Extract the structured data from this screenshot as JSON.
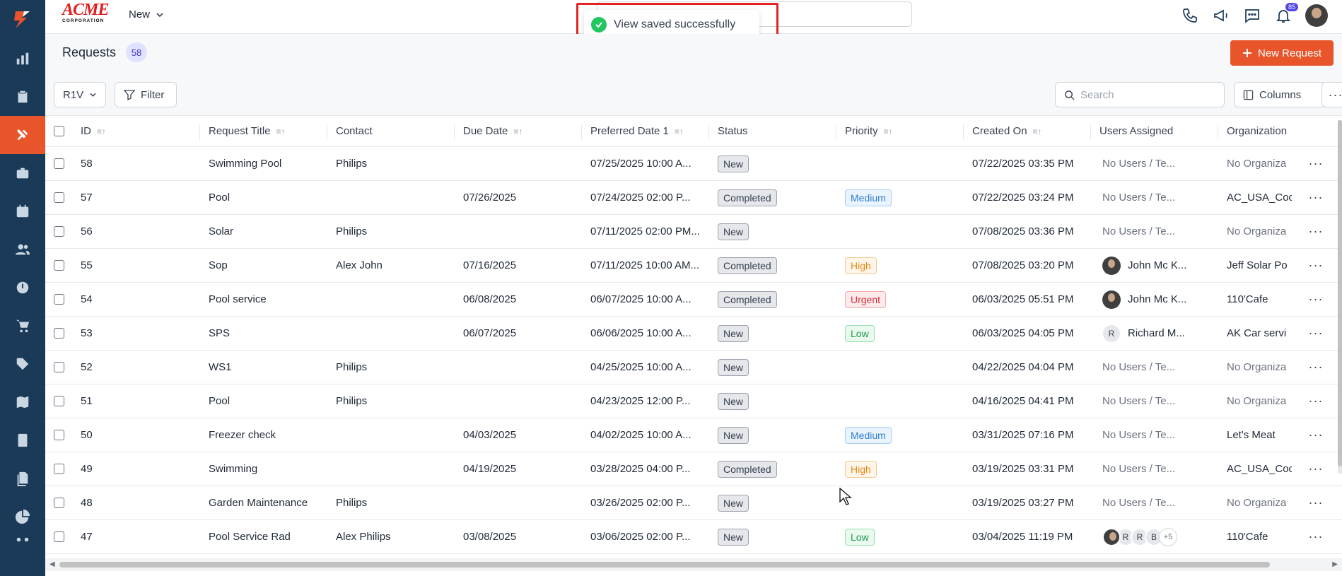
{
  "header": {
    "logo_word": "ACME",
    "logo_sub": "CORPORATION",
    "new_label": "New",
    "notification_count": "85"
  },
  "toast": {
    "message": "View saved successfully"
  },
  "page": {
    "title": "Requests",
    "count": "58",
    "new_button": "New Request"
  },
  "toolbar": {
    "view_label": "R1V",
    "filter_label": "Filter",
    "search_placeholder": "Search",
    "columns_label": "Columns"
  },
  "columns": {
    "id": "ID",
    "title": "Request Title",
    "contact": "Contact",
    "due": "Due Date",
    "pref": "Preferred Date 1",
    "status": "Status",
    "priority": "Priority",
    "created": "Created On",
    "users": "Users Assigned",
    "org": "Organization"
  },
  "rows": [
    {
      "id": "58",
      "title": "Swimming Pool",
      "contact": "Philips",
      "due": "",
      "pref": "07/25/2025 10:00 A...",
      "status": "New",
      "priority": "",
      "created": "07/22/2025 03:35 PM",
      "users": "No Users / Te...",
      "org": "No Organiza"
    },
    {
      "id": "57",
      "title": "Pool",
      "contact": "",
      "due": "07/26/2025",
      "pref": "07/24/2025 02:00 P...",
      "status": "Completed",
      "priority": "Medium",
      "created": "07/22/2025 03:24 PM",
      "users": "No Users / Te...",
      "org": "AC_USA_Coo"
    },
    {
      "id": "56",
      "title": "Solar",
      "contact": "Philips",
      "due": "",
      "pref": "07/11/2025 02:00 PM...",
      "status": "New",
      "priority": "",
      "created": "07/08/2025 03:36 PM",
      "users": "No Users / Te...",
      "org": "No Organiza"
    },
    {
      "id": "55",
      "title": "Sop",
      "contact": "Alex John",
      "due": "07/16/2025",
      "pref": "07/11/2025 10:00 AM...",
      "status": "Completed",
      "priority": "High",
      "created": "07/08/2025 03:20 PM",
      "users": "John Mc K...",
      "org": "Jeff Solar Po"
    },
    {
      "id": "54",
      "title": "Pool service",
      "contact": "",
      "due": "06/08/2025",
      "pref": "06/07/2025 10:00 A...",
      "status": "Completed",
      "priority": "Urgent",
      "created": "06/03/2025 05:51 PM",
      "users": "John Mc K...",
      "org": "110'Cafe"
    },
    {
      "id": "53",
      "title": "SPS",
      "contact": "",
      "due": "06/07/2025",
      "pref": "06/06/2025 10:00 A...",
      "status": "New",
      "priority": "Low",
      "created": "06/03/2025 04:05 PM",
      "users": "Richard M...",
      "user_initial": "R",
      "org": "AK Car servi"
    },
    {
      "id": "52",
      "title": "WS1",
      "contact": "Philips",
      "due": "",
      "pref": "04/25/2025 10:00 A...",
      "status": "New",
      "priority": "",
      "created": "04/22/2025 04:04 PM",
      "users": "No Users / Te...",
      "org": "No Organiza"
    },
    {
      "id": "51",
      "title": "Pool",
      "contact": "Philips",
      "due": "",
      "pref": "04/23/2025 12:00 P...",
      "status": "New",
      "priority": "",
      "created": "04/16/2025 04:41 PM",
      "users": "No Users / Te...",
      "org": "No Organiza"
    },
    {
      "id": "50",
      "title": "Freezer check",
      "contact": "",
      "due": "04/03/2025",
      "pref": "04/02/2025 10:00 A...",
      "status": "New",
      "priority": "Medium",
      "created": "03/31/2025 07:16 PM",
      "users": "No Users / Te...",
      "org": "Let's Meat"
    },
    {
      "id": "49",
      "title": "Swimming",
      "contact": "",
      "due": "04/19/2025",
      "pref": "03/28/2025 04:00 P...",
      "status": "Completed",
      "priority": "High",
      "created": "03/19/2025 03:31 PM",
      "users": "No Users / Te...",
      "org": "AC_USA_Coo"
    },
    {
      "id": "48",
      "title": "Garden Maintenance",
      "contact": "Philips",
      "due": "",
      "pref": "03/26/2025 02:00 P...",
      "status": "New",
      "priority": "",
      "created": "03/19/2025 03:27 PM",
      "users": "No Users / Te...",
      "org": "No Organiza"
    },
    {
      "id": "47",
      "title": "Pool Service Rad",
      "contact": "Alex Philips",
      "due": "03/08/2025",
      "pref": "03/06/2025 02:00 P...",
      "status": "New",
      "priority": "Low",
      "created": "03/04/2025 11:19 PM",
      "users": "",
      "stack": [
        "R",
        "R",
        "B",
        "+5"
      ],
      "org": "110'Cafe"
    }
  ],
  "sidebar_icons": [
    "logo-icon",
    "chart-icon",
    "clipboard-icon",
    "tools-icon",
    "briefcase-icon",
    "calendar-icon",
    "users-icon",
    "clock-icon",
    "cart-icon",
    "tag-icon",
    "map-icon",
    "calculator-icon",
    "documents-icon",
    "pie-chart-icon",
    "workflow-icon"
  ],
  "colors": {
    "sidebar": "#1b3a57",
    "accent": "#e8552b",
    "toast_frame": "#e32222"
  }
}
